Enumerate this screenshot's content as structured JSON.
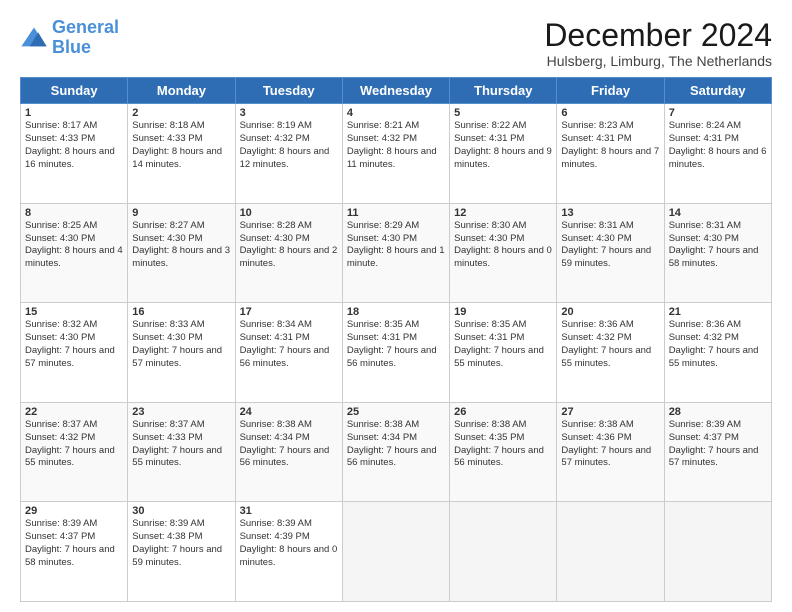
{
  "logo": {
    "line1": "General",
    "line2": "Blue"
  },
  "title": "December 2024",
  "subtitle": "Hulsberg, Limburg, The Netherlands",
  "headers": [
    "Sunday",
    "Monday",
    "Tuesday",
    "Wednesday",
    "Thursday",
    "Friday",
    "Saturday"
  ],
  "weeks": [
    [
      {
        "day": "1",
        "sunrise": "8:17 AM",
        "sunset": "4:33 PM",
        "daylight": "8 hours and 16 minutes."
      },
      {
        "day": "2",
        "sunrise": "8:18 AM",
        "sunset": "4:33 PM",
        "daylight": "8 hours and 14 minutes."
      },
      {
        "day": "3",
        "sunrise": "8:19 AM",
        "sunset": "4:32 PM",
        "daylight": "8 hours and 12 minutes."
      },
      {
        "day": "4",
        "sunrise": "8:21 AM",
        "sunset": "4:32 PM",
        "daylight": "8 hours and 11 minutes."
      },
      {
        "day": "5",
        "sunrise": "8:22 AM",
        "sunset": "4:31 PM",
        "daylight": "8 hours and 9 minutes."
      },
      {
        "day": "6",
        "sunrise": "8:23 AM",
        "sunset": "4:31 PM",
        "daylight": "8 hours and 7 minutes."
      },
      {
        "day": "7",
        "sunrise": "8:24 AM",
        "sunset": "4:31 PM",
        "daylight": "8 hours and 6 minutes."
      }
    ],
    [
      {
        "day": "8",
        "sunrise": "8:25 AM",
        "sunset": "4:30 PM",
        "daylight": "8 hours and 4 minutes."
      },
      {
        "day": "9",
        "sunrise": "8:27 AM",
        "sunset": "4:30 PM",
        "daylight": "8 hours and 3 minutes."
      },
      {
        "day": "10",
        "sunrise": "8:28 AM",
        "sunset": "4:30 PM",
        "daylight": "8 hours and 2 minutes."
      },
      {
        "day": "11",
        "sunrise": "8:29 AM",
        "sunset": "4:30 PM",
        "daylight": "8 hours and 1 minute."
      },
      {
        "day": "12",
        "sunrise": "8:30 AM",
        "sunset": "4:30 PM",
        "daylight": "8 hours and 0 minutes."
      },
      {
        "day": "13",
        "sunrise": "8:31 AM",
        "sunset": "4:30 PM",
        "daylight": "7 hours and 59 minutes."
      },
      {
        "day": "14",
        "sunrise": "8:31 AM",
        "sunset": "4:30 PM",
        "daylight": "7 hours and 58 minutes."
      }
    ],
    [
      {
        "day": "15",
        "sunrise": "8:32 AM",
        "sunset": "4:30 PM",
        "daylight": "7 hours and 57 minutes."
      },
      {
        "day": "16",
        "sunrise": "8:33 AM",
        "sunset": "4:30 PM",
        "daylight": "7 hours and 57 minutes."
      },
      {
        "day": "17",
        "sunrise": "8:34 AM",
        "sunset": "4:31 PM",
        "daylight": "7 hours and 56 minutes."
      },
      {
        "day": "18",
        "sunrise": "8:35 AM",
        "sunset": "4:31 PM",
        "daylight": "7 hours and 56 minutes."
      },
      {
        "day": "19",
        "sunrise": "8:35 AM",
        "sunset": "4:31 PM",
        "daylight": "7 hours and 55 minutes."
      },
      {
        "day": "20",
        "sunrise": "8:36 AM",
        "sunset": "4:32 PM",
        "daylight": "7 hours and 55 minutes."
      },
      {
        "day": "21",
        "sunrise": "8:36 AM",
        "sunset": "4:32 PM",
        "daylight": "7 hours and 55 minutes."
      }
    ],
    [
      {
        "day": "22",
        "sunrise": "8:37 AM",
        "sunset": "4:32 PM",
        "daylight": "7 hours and 55 minutes."
      },
      {
        "day": "23",
        "sunrise": "8:37 AM",
        "sunset": "4:33 PM",
        "daylight": "7 hours and 55 minutes."
      },
      {
        "day": "24",
        "sunrise": "8:38 AM",
        "sunset": "4:34 PM",
        "daylight": "7 hours and 56 minutes."
      },
      {
        "day": "25",
        "sunrise": "8:38 AM",
        "sunset": "4:34 PM",
        "daylight": "7 hours and 56 minutes."
      },
      {
        "day": "26",
        "sunrise": "8:38 AM",
        "sunset": "4:35 PM",
        "daylight": "7 hours and 56 minutes."
      },
      {
        "day": "27",
        "sunrise": "8:38 AM",
        "sunset": "4:36 PM",
        "daylight": "7 hours and 57 minutes."
      },
      {
        "day": "28",
        "sunrise": "8:39 AM",
        "sunset": "4:37 PM",
        "daylight": "7 hours and 57 minutes."
      }
    ],
    [
      {
        "day": "29",
        "sunrise": "8:39 AM",
        "sunset": "4:37 PM",
        "daylight": "7 hours and 58 minutes."
      },
      {
        "day": "30",
        "sunrise": "8:39 AM",
        "sunset": "4:38 PM",
        "daylight": "7 hours and 59 minutes."
      },
      {
        "day": "31",
        "sunrise": "8:39 AM",
        "sunset": "4:39 PM",
        "daylight": "8 hours and 0 minutes."
      },
      null,
      null,
      null,
      null
    ]
  ],
  "labels": {
    "sunrise": "Sunrise:",
    "sunset": "Sunset:",
    "daylight": "Daylight:"
  }
}
